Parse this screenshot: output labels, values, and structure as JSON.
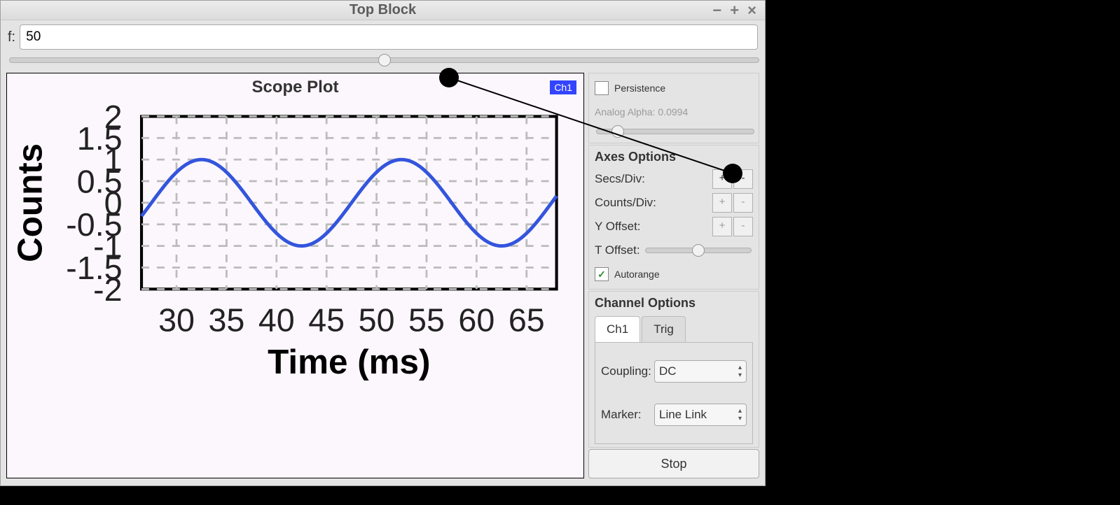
{
  "window": {
    "title": "Top Block"
  },
  "frequency": {
    "label": "f:",
    "value": "50",
    "slider_percent": 50
  },
  "plot": {
    "title": "Scope Plot",
    "legend": "Ch1",
    "xlabel": "Time (ms)",
    "ylabel": "Counts"
  },
  "chart_data": {
    "type": "line",
    "title": "Scope Plot",
    "xlabel": "Time (ms)",
    "ylabel": "Counts",
    "xlim": [
      26.5,
      68
    ],
    "ylim": [
      -2,
      2
    ],
    "xticks": [
      30,
      35,
      40,
      45,
      50,
      55,
      60,
      65
    ],
    "yticks": [
      -2,
      -1.5,
      -1,
      -0.5,
      0,
      0.5,
      1,
      1.5,
      2
    ],
    "series": [
      {
        "name": "Ch1",
        "color": "#3355dd",
        "function": "sin",
        "phase_zero_ms": 27.5,
        "period_ms": 20,
        "amplitude": 1.0,
        "offset": 0.0
      }
    ]
  },
  "sidebar": {
    "persistence": {
      "label": "Persistence",
      "checked": false
    },
    "analog_alpha": {
      "label": "Analog Alpha:",
      "value": "0.0994",
      "slider_percent": 10
    },
    "axes_header": "Axes Options",
    "secs_div_label": "Secs/Div:",
    "counts_div_label": "Counts/Div:",
    "y_offset_label": "Y Offset:",
    "t_offset_label": "T Offset:",
    "t_offset_percent": 50,
    "autorange": {
      "label": "Autorange",
      "checked": true
    },
    "channel_header": "Channel Options",
    "tabs": {
      "ch1": "Ch1",
      "trig": "Trig",
      "active": "ch1"
    },
    "coupling": {
      "label": "Coupling:",
      "value": "DC"
    },
    "marker": {
      "label": "Marker:",
      "value": "Line Link"
    },
    "stop": "Stop"
  }
}
